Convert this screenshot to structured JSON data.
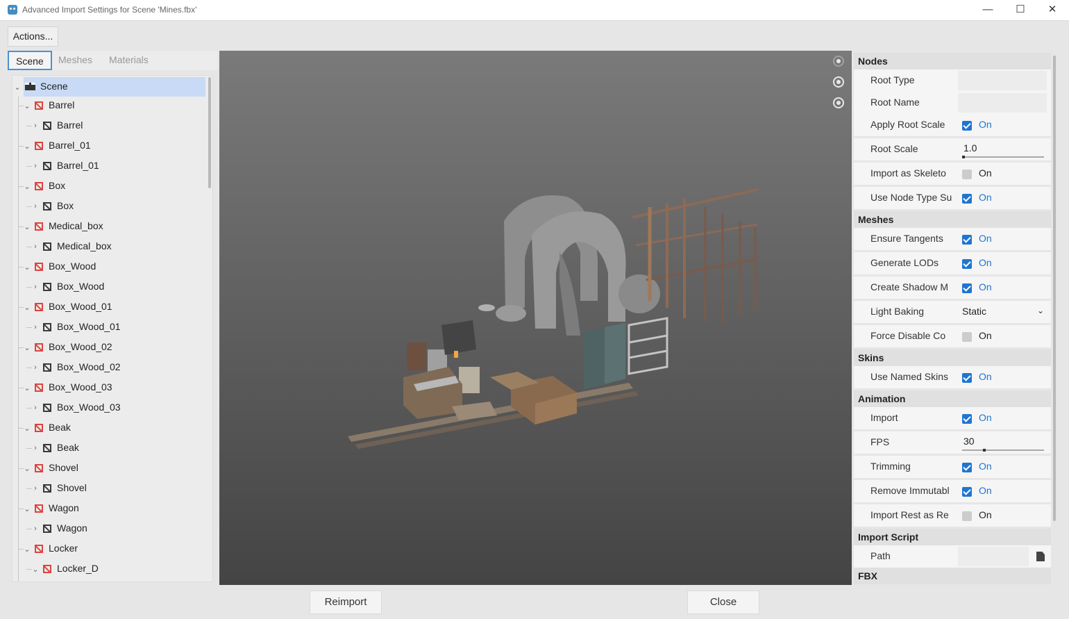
{
  "window": {
    "title": "Advanced Import Settings for Scene 'Mines.fbx'",
    "controls": {
      "minimize": "—",
      "maximize": "☐",
      "close": "✕"
    }
  },
  "toolbar": {
    "actions_label": "Actions..."
  },
  "tabs": [
    {
      "label": "Scene",
      "active": true
    },
    {
      "label": "Meshes",
      "active": false
    },
    {
      "label": "Materials",
      "active": false
    }
  ],
  "tree": {
    "root": "Scene",
    "items": [
      {
        "label": "Barrel",
        "level": 1,
        "icon": "node-red"
      },
      {
        "label": "Barrel",
        "level": 2,
        "icon": "node-dark"
      },
      {
        "label": "Barrel_01",
        "level": 1,
        "icon": "node-red"
      },
      {
        "label": "Barrel_01",
        "level": 2,
        "icon": "node-dark"
      },
      {
        "label": "Box",
        "level": 1,
        "icon": "node-red"
      },
      {
        "label": "Box",
        "level": 2,
        "icon": "node-dark"
      },
      {
        "label": "Medical_box",
        "level": 1,
        "icon": "node-red"
      },
      {
        "label": "Medical_box",
        "level": 2,
        "icon": "node-dark"
      },
      {
        "label": "Box_Wood",
        "level": 1,
        "icon": "node-red"
      },
      {
        "label": "Box_Wood",
        "level": 2,
        "icon": "node-dark"
      },
      {
        "label": "Box_Wood_01",
        "level": 1,
        "icon": "node-red"
      },
      {
        "label": "Box_Wood_01",
        "level": 2,
        "icon": "node-dark"
      },
      {
        "label": "Box_Wood_02",
        "level": 1,
        "icon": "node-red"
      },
      {
        "label": "Box_Wood_02",
        "level": 2,
        "icon": "node-dark"
      },
      {
        "label": "Box_Wood_03",
        "level": 1,
        "icon": "node-red"
      },
      {
        "label": "Box_Wood_03",
        "level": 2,
        "icon": "node-dark"
      },
      {
        "label": "Beak",
        "level": 1,
        "icon": "node-red"
      },
      {
        "label": "Beak",
        "level": 2,
        "icon": "node-dark"
      },
      {
        "label": "Shovel",
        "level": 1,
        "icon": "node-red"
      },
      {
        "label": "Shovel",
        "level": 2,
        "icon": "node-dark"
      },
      {
        "label": "Wagon",
        "level": 1,
        "icon": "node-red"
      },
      {
        "label": "Wagon",
        "level": 2,
        "icon": "node-dark"
      },
      {
        "label": "Locker",
        "level": 1,
        "icon": "node-red"
      },
      {
        "label": "Locker_D",
        "level": 2,
        "icon": "node-red",
        "expanded": true
      }
    ]
  },
  "inspector": {
    "sections": [
      {
        "title": "Nodes",
        "rows": [
          {
            "label": "Root Type",
            "type": "text",
            "value": ""
          },
          {
            "label": "Root Name",
            "type": "text",
            "value": ""
          },
          {
            "label": "Apply Root Scale",
            "type": "check",
            "checked": true,
            "value": "On"
          },
          {
            "label": "Root Scale",
            "type": "number",
            "value": "1.0",
            "slider": 0.0
          },
          {
            "label": "Import as Skeleto",
            "type": "check",
            "checked": false,
            "value": "On"
          },
          {
            "label": "Use Node Type Su",
            "type": "check",
            "checked": true,
            "value": "On"
          }
        ]
      },
      {
        "title": "Meshes",
        "rows": [
          {
            "label": "Ensure Tangents",
            "type": "check",
            "checked": true,
            "value": "On"
          },
          {
            "label": "Generate LODs",
            "type": "check",
            "checked": true,
            "value": "On"
          },
          {
            "label": "Create Shadow M",
            "type": "check",
            "checked": true,
            "value": "On"
          },
          {
            "label": "Light Baking",
            "type": "select",
            "value": "Static"
          },
          {
            "label": "Force Disable Co",
            "type": "check",
            "checked": false,
            "value": "On"
          }
        ]
      },
      {
        "title": "Skins",
        "rows": [
          {
            "label": "Use Named Skins",
            "type": "check",
            "checked": true,
            "value": "On"
          }
        ]
      },
      {
        "title": "Animation",
        "rows": [
          {
            "label": "Import",
            "type": "check",
            "checked": true,
            "value": "On"
          },
          {
            "label": "FPS",
            "type": "number",
            "value": "30",
            "slider": 0.25
          },
          {
            "label": "Trimming",
            "type": "check",
            "checked": true,
            "value": "On"
          },
          {
            "label": "Remove Immutabl",
            "type": "check",
            "checked": true,
            "value": "On"
          },
          {
            "label": "Import Rest as Re",
            "type": "check",
            "checked": false,
            "value": "On"
          }
        ]
      },
      {
        "title": "Import Script",
        "rows": [
          {
            "label": "Path",
            "type": "file",
            "value": ""
          }
        ]
      },
      {
        "title": "FBX",
        "rows": []
      }
    ]
  },
  "footer": {
    "reimport_label": "Reimport",
    "close_label": "Close"
  },
  "colors": {
    "accent": "#1f75d1",
    "node_icon": "#d9453f",
    "selection": "#c8daf5"
  }
}
